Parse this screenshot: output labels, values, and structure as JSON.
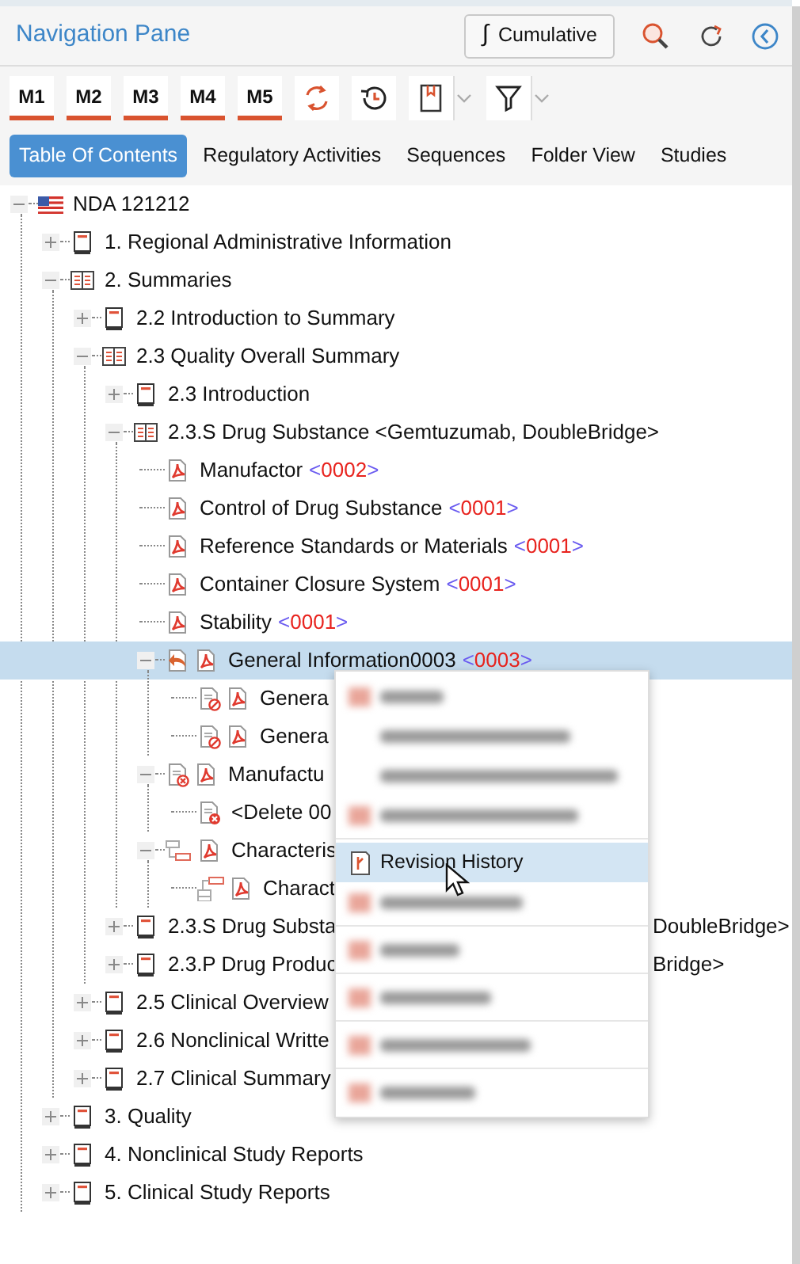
{
  "panel": {
    "title": "Navigation Pane",
    "cumulative_button": {
      "symbol": "∫",
      "label": "Cumulative"
    }
  },
  "module_buttons": [
    {
      "label": "M1"
    },
    {
      "label": "M2"
    },
    {
      "label": "M3"
    },
    {
      "label": "M4"
    },
    {
      "label": "M5"
    }
  ],
  "tabs": [
    {
      "label": "Table Of Contents",
      "selected": true
    },
    {
      "label": "Regulatory Activities",
      "selected": false
    },
    {
      "label": "Sequences",
      "selected": false
    },
    {
      "label": "Folder View",
      "selected": false
    },
    {
      "label": "Studies",
      "selected": false
    }
  ],
  "tree": [
    {
      "label": "NDA 121212",
      "icons": [
        {
          "kind": "flag"
        }
      ],
      "expanded": true,
      "selected": false,
      "children": [
        {
          "label": "1. Regional Administrative Information",
          "icons": [
            {
              "kind": "book"
            }
          ],
          "expanded": false,
          "selected": false
        },
        {
          "label": "2. Summaries",
          "icons": [
            {
              "kind": "open-book"
            }
          ],
          "expanded": true,
          "selected": false,
          "children": [
            {
              "label": "2.2 Introduction to Summary",
              "icons": [
                {
                  "kind": "book"
                }
              ],
              "expanded": false,
              "selected": false
            },
            {
              "label": "2.3 Quality Overall Summary",
              "icons": [
                {
                  "kind": "open-book"
                }
              ],
              "expanded": true,
              "selected": false,
              "children": [
                {
                  "label": "2.3 Introduction",
                  "icons": [
                    {
                      "kind": "book"
                    }
                  ],
                  "expanded": false,
                  "selected": false
                },
                {
                  "label": "2.3.S Drug Substance <Gemtuzumab, DoubleBridge>",
                  "icons": [
                    {
                      "kind": "open-book"
                    }
                  ],
                  "expanded": true,
                  "selected": false,
                  "children": [
                    {
                      "label": "Manufactor",
                      "version": "<0002>",
                      "icons": [
                        {
                          "kind": "pdf"
                        }
                      ],
                      "selected": false
                    },
                    {
                      "label": "Control of Drug Substance",
                      "version": "<0001>",
                      "icons": [
                        {
                          "kind": "pdf"
                        }
                      ],
                      "selected": false
                    },
                    {
                      "label": "Reference Standards or Materials",
                      "version": "<0001>",
                      "icons": [
                        {
                          "kind": "pdf"
                        }
                      ],
                      "selected": false
                    },
                    {
                      "label": "Container Closure System",
                      "version": "<0001>",
                      "icons": [
                        {
                          "kind": "pdf"
                        }
                      ],
                      "selected": false
                    },
                    {
                      "label": "Stability",
                      "version": "<0001>",
                      "icons": [
                        {
                          "kind": "pdf"
                        }
                      ],
                      "selected": false
                    },
                    {
                      "label": "General Information0003",
                      "version": "<0003>",
                      "icons": [
                        {
                          "kind": "replace"
                        },
                        {
                          "kind": "pdf"
                        }
                      ],
                      "expanded": true,
                      "selected": true,
                      "children": [
                        {
                          "label": "Genera",
                          "icons": [
                            {
                              "kind": "blocked-doc"
                            },
                            {
                              "kind": "pdf"
                            }
                          ],
                          "selected": false
                        },
                        {
                          "label": "Genera",
                          "icons": [
                            {
                              "kind": "blocked-doc"
                            },
                            {
                              "kind": "pdf"
                            }
                          ],
                          "selected": false
                        }
                      ]
                    },
                    {
                      "label": "Manufactu",
                      "icons": [
                        {
                          "kind": "delete-doc"
                        },
                        {
                          "kind": "pdf"
                        }
                      ],
                      "expanded": true,
                      "selected": false,
                      "children": [
                        {
                          "label": "<Delete 00",
                          "icons": [
                            {
                              "kind": "deleted-doc"
                            }
                          ],
                          "selected": false
                        }
                      ]
                    },
                    {
                      "label": "Characteris",
                      "icons": [
                        {
                          "kind": "hierarchy"
                        },
                        {
                          "kind": "pdf"
                        }
                      ],
                      "expanded": true,
                      "selected": false,
                      "children": [
                        {
                          "label": "Charact",
                          "icons": [
                            {
                              "kind": "hierarchy-child"
                            },
                            {
                              "kind": "pdf"
                            }
                          ],
                          "selected": false
                        }
                      ]
                    }
                  ]
                },
                {
                  "label": "2.3.S Drug Substa",
                  "label_tail": "DoubleBridge>",
                  "icons": [
                    {
                      "kind": "book"
                    }
                  ],
                  "expanded": false,
                  "selected": false
                },
                {
                  "label": "2.3.P Drug Produc",
                  "label_tail": "Bridge>",
                  "icons": [
                    {
                      "kind": "book"
                    }
                  ],
                  "expanded": false,
                  "selected": false
                }
              ]
            },
            {
              "label": "2.5 Clinical Overview",
              "icons": [
                {
                  "kind": "book"
                }
              ],
              "expanded": false,
              "selected": false
            },
            {
              "label": "2.6 Nonclinical Writte",
              "icons": [
                {
                  "kind": "book"
                }
              ],
              "expanded": false,
              "selected": false
            },
            {
              "label": "2.7 Clinical Summary",
              "icons": [
                {
                  "kind": "book"
                }
              ],
              "expanded": false,
              "selected": false
            }
          ]
        },
        {
          "label": "3. Quality",
          "icons": [
            {
              "kind": "book"
            }
          ],
          "expanded": false,
          "selected": false
        },
        {
          "label": "4. Nonclinical Study Reports",
          "icons": [
            {
              "kind": "book"
            }
          ],
          "expanded": false,
          "selected": false
        },
        {
          "label": "5. Clinical Study Reports",
          "icons": [
            {
              "kind": "book"
            }
          ],
          "expanded": false,
          "selected": false
        }
      ]
    }
  ],
  "context_menu": {
    "items": [
      {
        "kind": "blurred",
        "selected": false
      },
      {
        "kind": "blurred",
        "selected": false
      },
      {
        "kind": "blurred",
        "selected": false
      },
      {
        "kind": "blurred",
        "selected": false
      },
      {
        "kind": "separator"
      },
      {
        "kind": "item",
        "label": "Revision History",
        "selected": true
      },
      {
        "kind": "blurred",
        "selected": false
      },
      {
        "kind": "separator"
      },
      {
        "kind": "blurred",
        "selected": false
      },
      {
        "kind": "separator"
      },
      {
        "kind": "blurred",
        "selected": false
      },
      {
        "kind": "separator"
      },
      {
        "kind": "blurred",
        "selected": false
      },
      {
        "kind": "separator"
      },
      {
        "kind": "blurred",
        "selected": false
      }
    ]
  }
}
